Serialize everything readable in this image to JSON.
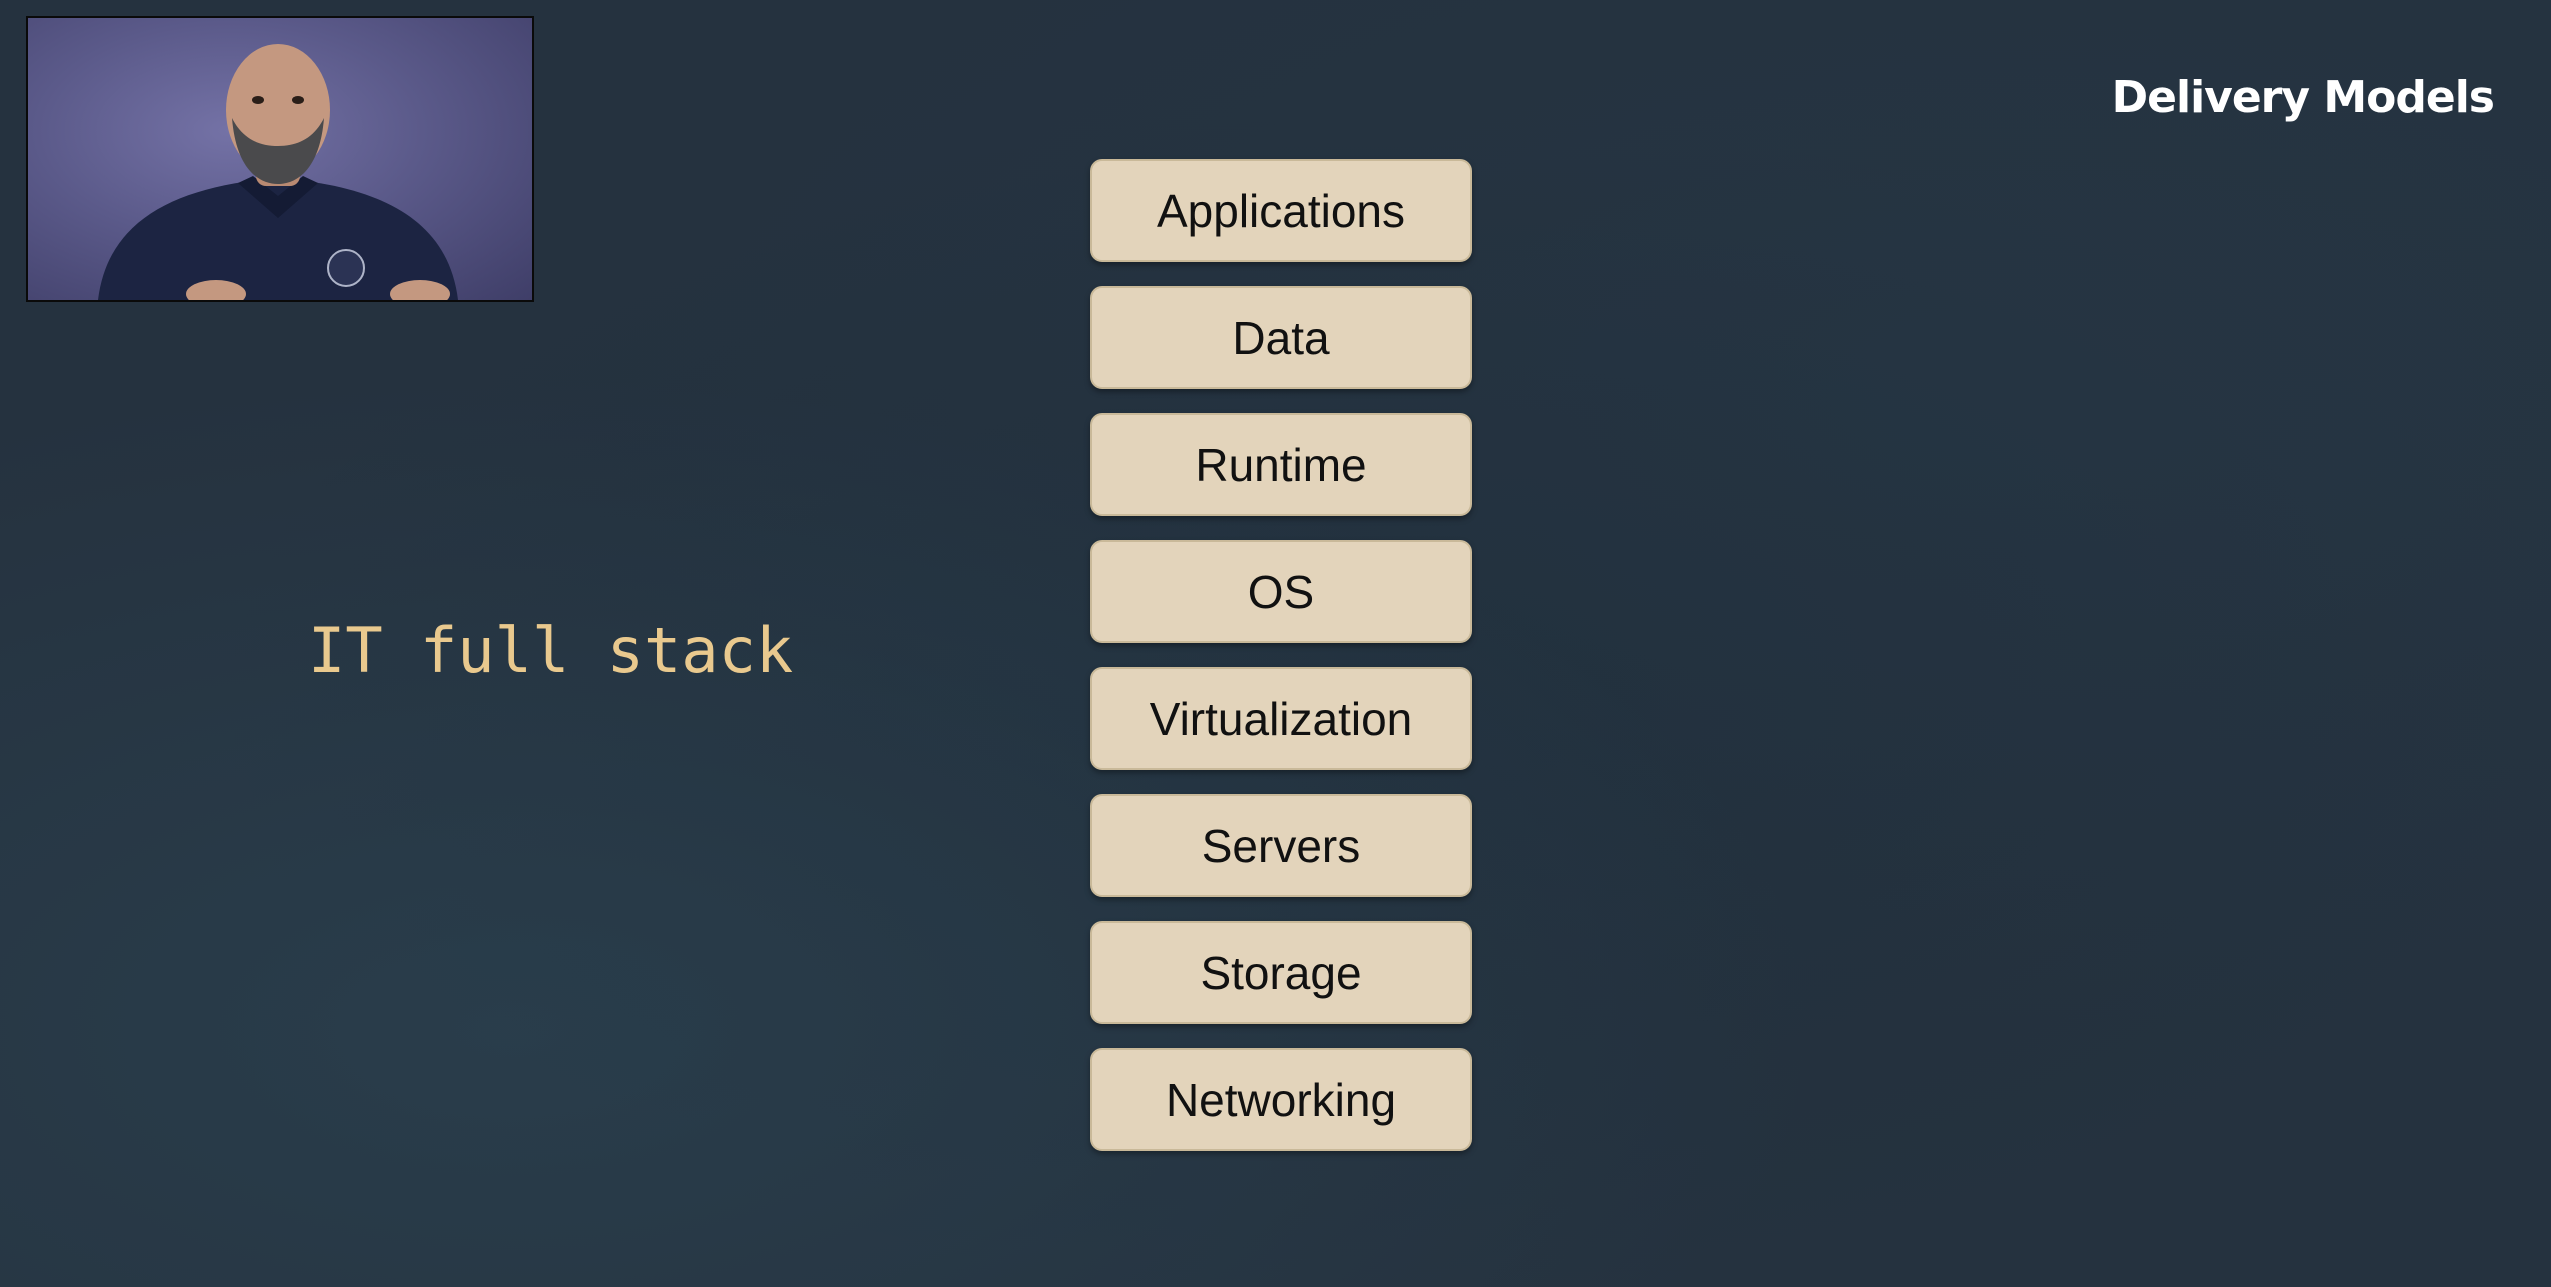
{
  "slide": {
    "title": "Delivery Models",
    "caption": "IT full stack"
  },
  "stack": {
    "layers": [
      {
        "label": "Applications"
      },
      {
        "label": "Data"
      },
      {
        "label": "Runtime"
      },
      {
        "label": "OS"
      },
      {
        "label": "Virtualization"
      },
      {
        "label": "Servers"
      },
      {
        "label": "Storage"
      },
      {
        "label": "Networking"
      }
    ]
  },
  "colors": {
    "background": "#25323f",
    "caption": "#e9c98e",
    "layer_fill": "#e3d4bb",
    "title": "#ffffff"
  }
}
